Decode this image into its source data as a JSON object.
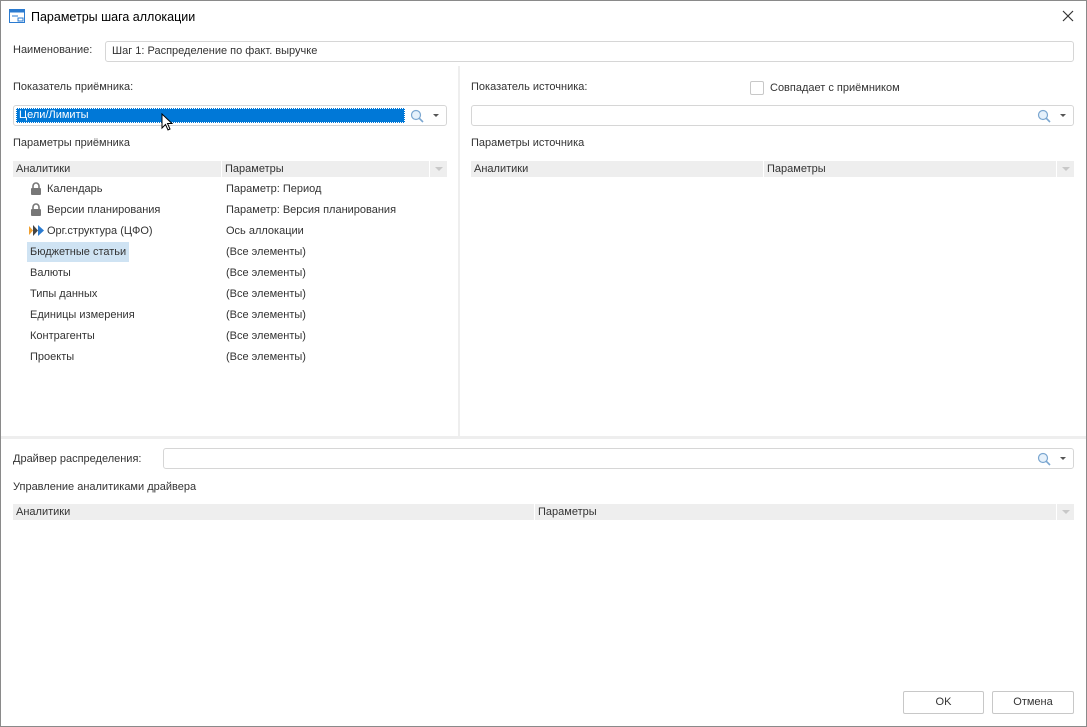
{
  "title": "Параметры шага аллокации",
  "name_label": "Наименование:",
  "name_value": "Шаг 1: Распределение по факт. выручке",
  "receiver": {
    "label": "Показатель приёмника:",
    "value": "Цели/Лимиты",
    "params_label": "Параметры приёмника",
    "columns": [
      "Аналитики",
      "Параметры"
    ],
    "rows": [
      {
        "name": "Календарь",
        "param": "Параметр: Период",
        "icon": "lock-icon"
      },
      {
        "name": "Версии планирования",
        "param": "Параметр: Версия планирования",
        "icon": "lock-icon"
      },
      {
        "name": "Орг.структура (ЦФО)",
        "param": "Ось аллокации",
        "icon": "allocation-axis-icon"
      },
      {
        "name": "Бюджетные статьи",
        "param": "(Все элементы)",
        "selected": true
      },
      {
        "name": "Валюты",
        "param": "(Все элементы)"
      },
      {
        "name": "Типы данных",
        "param": "(Все элементы)"
      },
      {
        "name": "Единицы измерения",
        "param": "(Все элементы)"
      },
      {
        "name": "Контрагенты",
        "param": "(Все элементы)"
      },
      {
        "name": "Проекты",
        "param": "(Все элементы)"
      }
    ]
  },
  "source": {
    "label": "Показатель источника:",
    "same_label": "Совпадает с приёмником",
    "same_checked": false,
    "value": "",
    "params_label": "Параметры источника",
    "columns": [
      "Аналитики",
      "Параметры"
    ]
  },
  "driver": {
    "label": "Драйвер распределения:",
    "value": "",
    "manage_label": "Управление аналитиками драйвера",
    "columns": [
      "Аналитики",
      "Параметры"
    ]
  },
  "buttons": {
    "ok": "OK",
    "cancel": "Отмена"
  }
}
